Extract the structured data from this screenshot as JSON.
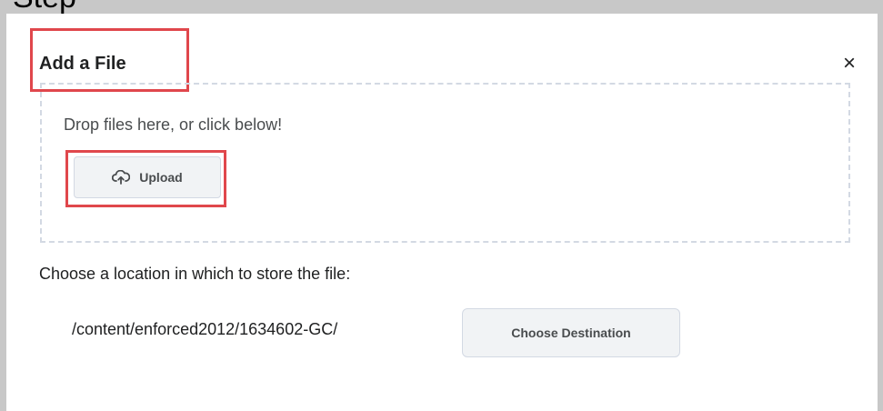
{
  "background_caption": {
    "partial_text": "Step"
  },
  "dialog": {
    "title": "Add a File",
    "close_symbol": "×",
    "dropzone": {
      "message": "Drop files here, or click below!",
      "upload_label": "Upload",
      "upload_icon": "cloud-upload-icon"
    },
    "location": {
      "label": "Choose a location in which to store the file:",
      "path": "/content/enforced2012/1634602-GC/",
      "choose_button_label": "Choose Destination"
    }
  },
  "colors": {
    "highlight": "#e0474c",
    "button_bg": "#f1f3f5",
    "dashed_border": "#d3d9e3",
    "frame_gray": "#c8c8c8"
  }
}
